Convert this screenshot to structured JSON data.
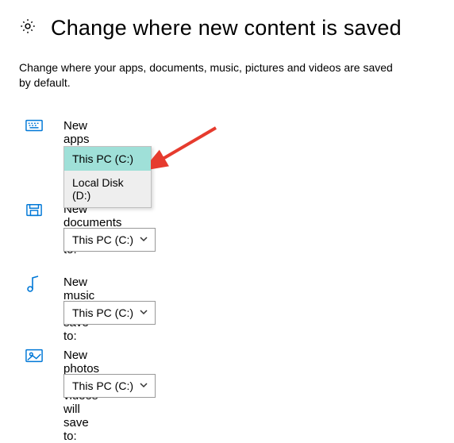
{
  "header": {
    "title": "Change where new content is saved"
  },
  "description": "Change where your apps, documents, music, pictures and videos are saved by default.",
  "apps": {
    "label": "New apps will save to:",
    "selected": "This PC (C:)",
    "options": [
      "This PC (C:)",
      "Local Disk (D:)"
    ]
  },
  "documents": {
    "label": "New documents will save to:",
    "selected": "This PC (C:)"
  },
  "music": {
    "label": "New music will save to:",
    "selected": "This PC (C:)"
  },
  "photos": {
    "label": "New photos and videos will save to:",
    "selected": "This PC (C:)"
  }
}
